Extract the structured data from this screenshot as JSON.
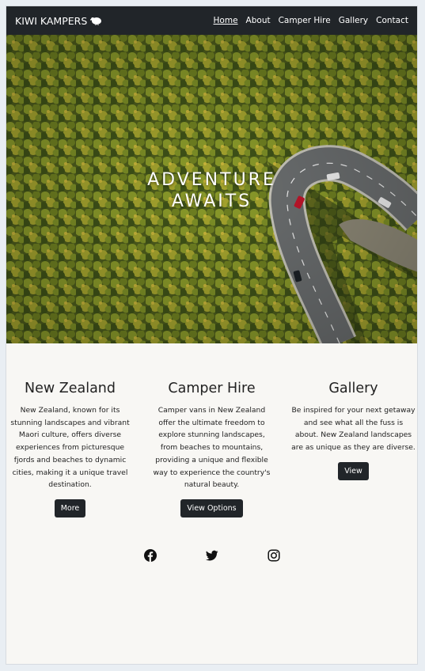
{
  "nav": {
    "brand": "KIWI KAMPERS",
    "brand_icon": "kiwi-bird-icon",
    "links": [
      "Home",
      "About",
      "Camper Hire",
      "Gallery",
      "Contact"
    ],
    "active": "Home"
  },
  "hero": {
    "title_line1": "ADVENTURE",
    "title_line2": "AWAITS"
  },
  "cards": [
    {
      "title": "New Zealand",
      "text": "New Zealand, known for its stunning landscapes and vibrant Maori culture, offers diverse experiences from picturesque fjords and beaches to dynamic cities, making it a unique travel destination.",
      "button": "More"
    },
    {
      "title": "Camper Hire",
      "text": "Camper vans in New Zealand offer the ultimate freedom to explore stunning landscapes, from beaches to mountains, providing a unique and flexible way to experience the country's natural beauty.",
      "button": "View Options"
    },
    {
      "title": "Gallery",
      "text": "Be inspired for your next getaway and see what all the fuss is about. New Zealand landscapes are as unique as they are diverse.",
      "button": "View"
    }
  ],
  "social": [
    "facebook-icon",
    "twitter-icon",
    "instagram-icon"
  ],
  "colors": {
    "nav_bg": "#212529",
    "page_bg": "#f8f7f4",
    "button_bg": "#212529"
  }
}
